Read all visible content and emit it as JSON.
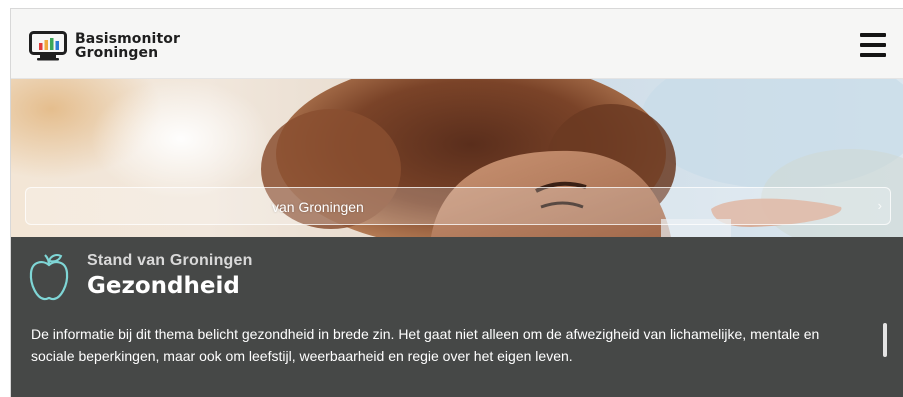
{
  "header": {
    "logo_line1": "Basismonitor",
    "logo_line2": "Groningen",
    "logo_icon": "monitor-bar-chart-icon",
    "menu_icon": "hamburger-menu-icon"
  },
  "hero": {
    "search_text": "van Groningen"
  },
  "theme": {
    "icon": "apple-icon",
    "subtitle": "Stand van Groningen",
    "title": "Gezondheid",
    "description": "De informatie bij dit thema belicht gezondheid in brede zin. Het gaat niet alleen om de afwezigheid van lichamelijke, mentale en sociale beperkingen, maar ook om leefstijl, weerbaarheid en regie over het eigen leven."
  },
  "colors": {
    "panel_background": "#464847",
    "accent_teal": "#7fd6d6",
    "logo_bars": [
      "#e03a3a",
      "#f0a83c",
      "#3aa65a",
      "#2a7bd4"
    ]
  }
}
